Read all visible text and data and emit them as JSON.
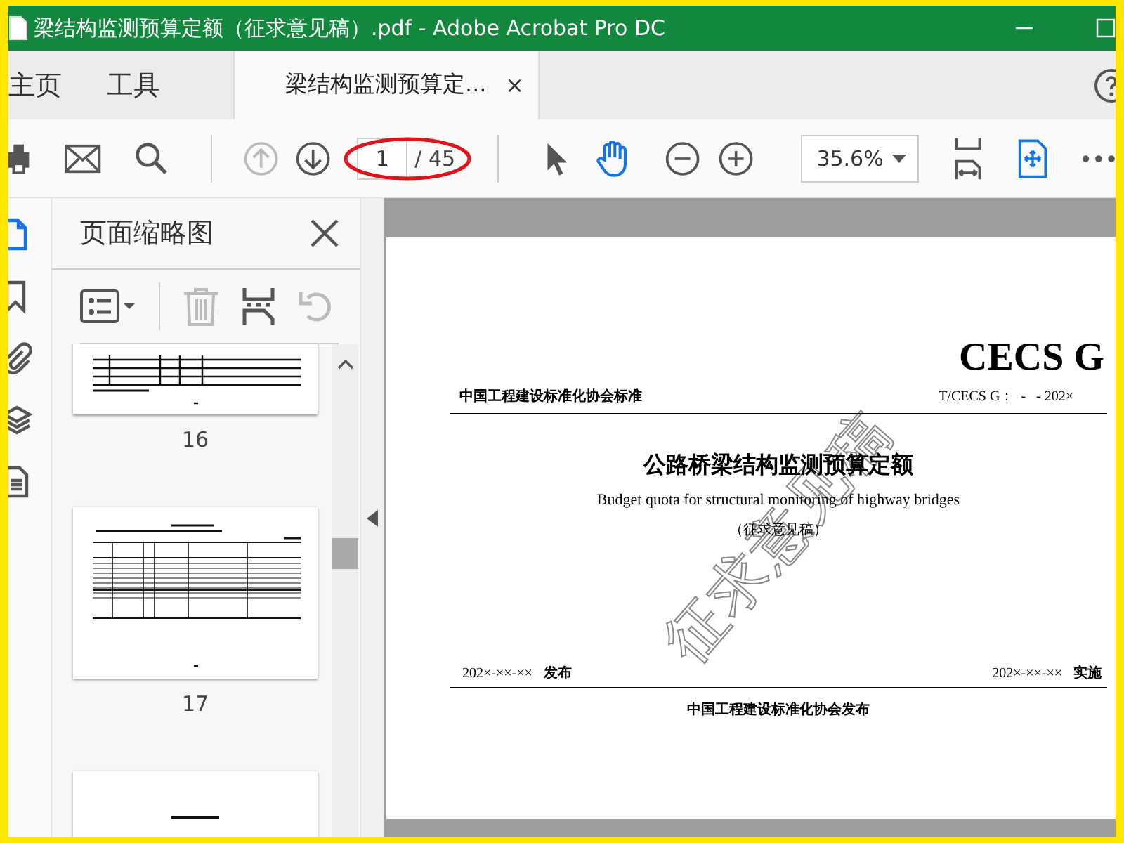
{
  "window": {
    "title": "梁结构监测预算定额（征求意见稿）.pdf - Adobe Acrobat Pro DC"
  },
  "nav_tabs": [
    {
      "label": "主页",
      "selected": false
    },
    {
      "label": "工具",
      "selected": false
    }
  ],
  "document_tab": {
    "label": "梁结构监测预算定...",
    "close": "×",
    "selected": true
  },
  "toolbar": {
    "page_current": "1",
    "page_total": "/ 45",
    "zoom": "35.6%",
    "tools": [
      {
        "kind": "select",
        "selected": false
      },
      {
        "kind": "hand",
        "selected": true
      }
    ]
  },
  "sidebar": {
    "rail": [
      {
        "kind": "pages",
        "selected": true
      },
      {
        "kind": "bookmarks",
        "selected": false
      },
      {
        "kind": "attachments",
        "selected": false
      },
      {
        "kind": "layers",
        "selected": false
      },
      {
        "kind": "content",
        "selected": false
      }
    ],
    "panel_title": "页面缩略图",
    "thumbnails": [
      {
        "kind": "table_end",
        "label": "16"
      },
      {
        "kind": "table",
        "label": "17"
      },
      {
        "kind": "heading"
      }
    ]
  },
  "document": {
    "code": "CECS G",
    "org_standard": "中国工程建设标准化协会标准",
    "number": "T/CECS G：  -   - 202×",
    "title": "公路桥梁结构监测预算定额",
    "subtitle": "Budget quota for structural monitoring of highway bridges",
    "status": "（征求意见稿）",
    "stamp": "征求意见稿",
    "issue_date": "202×-××-××",
    "issue_label": "发布",
    "effective_date": "202×-××-××",
    "effective_label": "实施",
    "publisher": "中国工程建设标准化协会发布"
  }
}
